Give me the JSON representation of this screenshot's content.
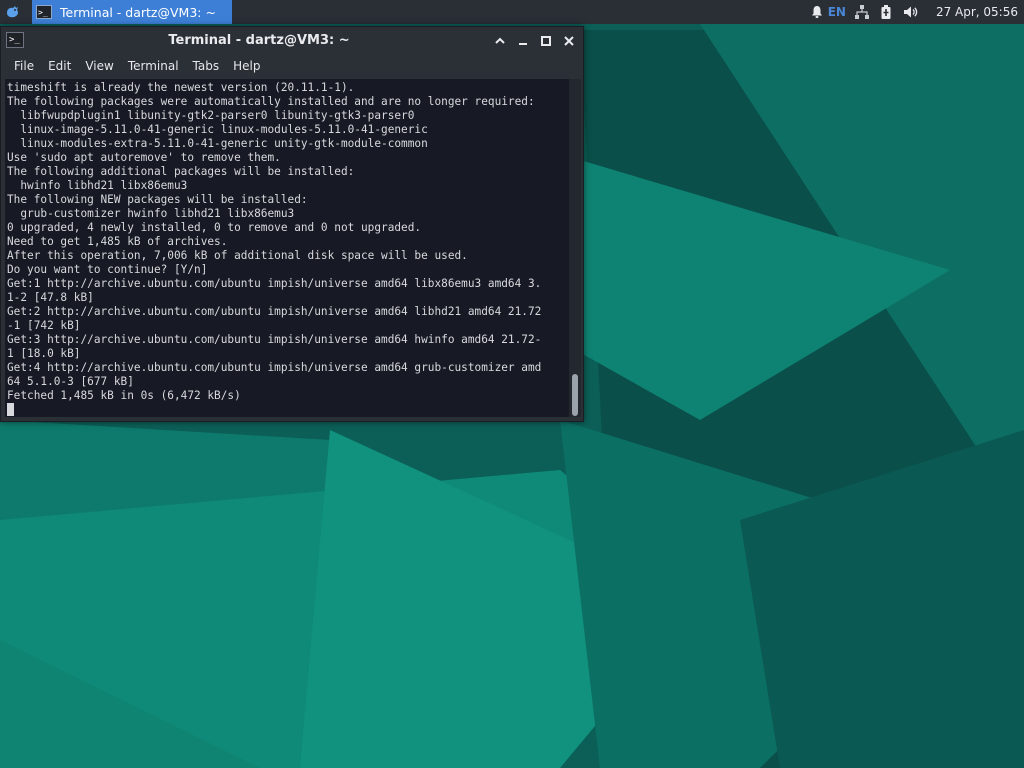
{
  "taskbar": {
    "task_label": "Terminal - dartz@VM3: ~",
    "task_icon_glyph": ">_"
  },
  "tray": {
    "language": "EN",
    "clock": "27 Apr, 05:56",
    "icons": [
      "notification-bell-icon",
      "network-icon",
      "battery-icon",
      "volume-icon"
    ]
  },
  "window": {
    "title": "Terminal - dartz@VM3: ~",
    "icon_glyph": ">_",
    "controls": [
      "shade-icon",
      "minimize-icon",
      "maximize-icon",
      "close-icon"
    ]
  },
  "menubar": {
    "items": [
      "File",
      "Edit",
      "View",
      "Terminal",
      "Tabs",
      "Help"
    ]
  },
  "terminal": {
    "lines": [
      "timeshift is already the newest version (20.11.1-1).",
      "The following packages were automatically installed and are no longer required:",
      "  libfwupdplugin1 libunity-gtk2-parser0 libunity-gtk3-parser0",
      "  linux-image-5.11.0-41-generic linux-modules-5.11.0-41-generic",
      "  linux-modules-extra-5.11.0-41-generic unity-gtk-module-common",
      "Use 'sudo apt autoremove' to remove them.",
      "The following additional packages will be installed:",
      "  hwinfo libhd21 libx86emu3",
      "The following NEW packages will be installed:",
      "  grub-customizer hwinfo libhd21 libx86emu3",
      "0 upgraded, 4 newly installed, 0 to remove and 0 not upgraded.",
      "Need to get 1,485 kB of archives.",
      "After this operation, 7,006 kB of additional disk space will be used.",
      "Do you want to continue? [Y/n]",
      "Get:1 http://archive.ubuntu.com/ubuntu impish/universe amd64 libx86emu3 amd64 3.",
      "1-2 [47.8 kB]",
      "Get:2 http://archive.ubuntu.com/ubuntu impish/universe amd64 libhd21 amd64 21.72",
      "-1 [742 kB]",
      "Get:3 http://archive.ubuntu.com/ubuntu impish/universe amd64 hwinfo amd64 21.72-",
      "1 [18.0 kB]",
      "Get:4 http://archive.ubuntu.com/ubuntu impish/universe amd64 grub-customizer amd",
      "64 5.1.0-3 [677 kB]",
      "Fetched 1,485 kB in 0s (6,472 kB/s)"
    ]
  },
  "colors": {
    "panel_bg": "#2a2e35",
    "task_active": "#3d7fd6",
    "terminal_bg": "#171a24",
    "terminal_fg": "#d7d9dd",
    "wallpaper_base": "#0b5f57"
  }
}
